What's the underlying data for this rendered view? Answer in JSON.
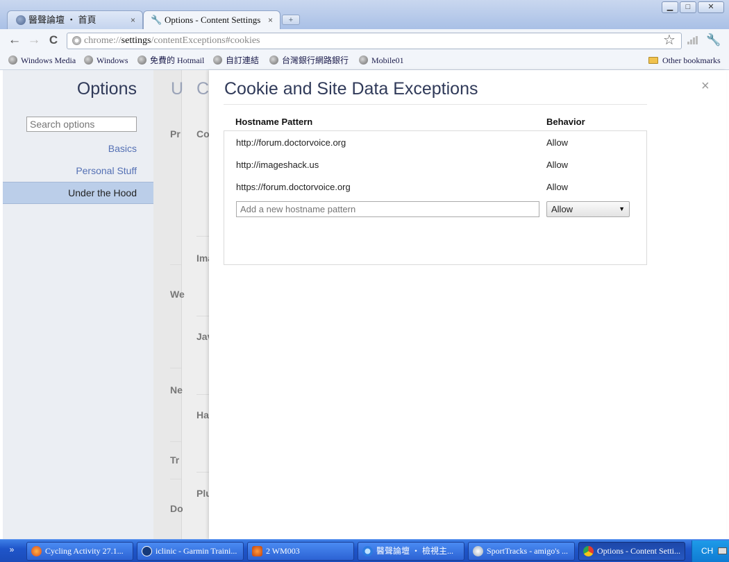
{
  "browser": {
    "tabs": [
      {
        "label": "醫聲論壇 ‧ 首頁",
        "icon": "globe-icon",
        "active": false
      },
      {
        "label": "Options - Content Settings",
        "icon": "wrench-icon",
        "active": true
      }
    ],
    "tab_close_glyph": "×",
    "new_tab_glyph": "+",
    "window_controls": {
      "minimize": "▁",
      "maximize": "□",
      "close": "✕"
    },
    "nav": {
      "back": "←",
      "forward": "→",
      "reload": "C"
    },
    "url": {
      "scheme": "chrome://",
      "host": "settings",
      "path": "/contentExceptions#cookies"
    },
    "star_glyph": "☆",
    "wrench_glyph": "🔧",
    "bookmarks": [
      {
        "label": "Windows Media",
        "icon": "globe-icon"
      },
      {
        "label": "Windows",
        "icon": "globe-icon"
      },
      {
        "label": "免費的 Hotmail",
        "icon": "globe-icon"
      },
      {
        "label": "自訂連結",
        "icon": "globe-icon"
      },
      {
        "label": "台灣銀行網路銀行",
        "icon": "globe-icon"
      },
      {
        "label": "Mobile01",
        "icon": "globe-icon"
      }
    ],
    "other_bookmarks": "Other bookmarks"
  },
  "options": {
    "title": "Options",
    "search_placeholder": "Search options",
    "nav": {
      "basics": "Basics",
      "personal": "Personal Stuff",
      "hood": "Under the Hood"
    }
  },
  "background": {
    "page_title_letter": "U",
    "subpage_title_letter": "C",
    "left_labels": [
      "Pr",
      "We",
      "Ne",
      "Tr",
      "Do"
    ],
    "right_labels": [
      "Co",
      "Ima",
      "Jav",
      "Ha",
      "Plu"
    ]
  },
  "dialog": {
    "title": "Cookie and Site Data Exceptions",
    "close_glyph": "×",
    "col_pattern": "Hostname Pattern",
    "col_behavior": "Behavior",
    "rows": [
      {
        "pattern": "http://forum.doctorvoice.org",
        "behavior": "Allow"
      },
      {
        "pattern": "http://imageshack.us",
        "behavior": "Allow"
      },
      {
        "pattern": "https://forum.doctorvoice.org",
        "behavior": "Allow"
      }
    ],
    "new_pattern_placeholder": "Add a new hostname pattern",
    "new_behavior": "Allow"
  },
  "taskbar": {
    "quick_glyph": "»",
    "items": [
      {
        "label": "Cycling Activity 27.1...",
        "icon": "firefox-icon",
        "active": false
      },
      {
        "label": "iclinic - Garmin Traini...",
        "icon": "tc-icon",
        "active": false
      },
      {
        "label": "2 WM003",
        "icon": "fox-icon",
        "active": false
      },
      {
        "label": "醫聲論壇 ‧ 檢視主...",
        "icon": "ie-icon",
        "active": false
      },
      {
        "label": "SportTracks - amigo's ...",
        "icon": "sporttracks-icon",
        "active": false
      },
      {
        "label": "Options - Content Setti...",
        "icon": "chrome-icon",
        "active": true
      }
    ],
    "tray_lang": "CH"
  },
  "colors": {
    "accent_link": "#5470b4",
    "title": "#303a59",
    "nav_selected": "#bbcee9",
    "taskbar": "#245edb"
  }
}
